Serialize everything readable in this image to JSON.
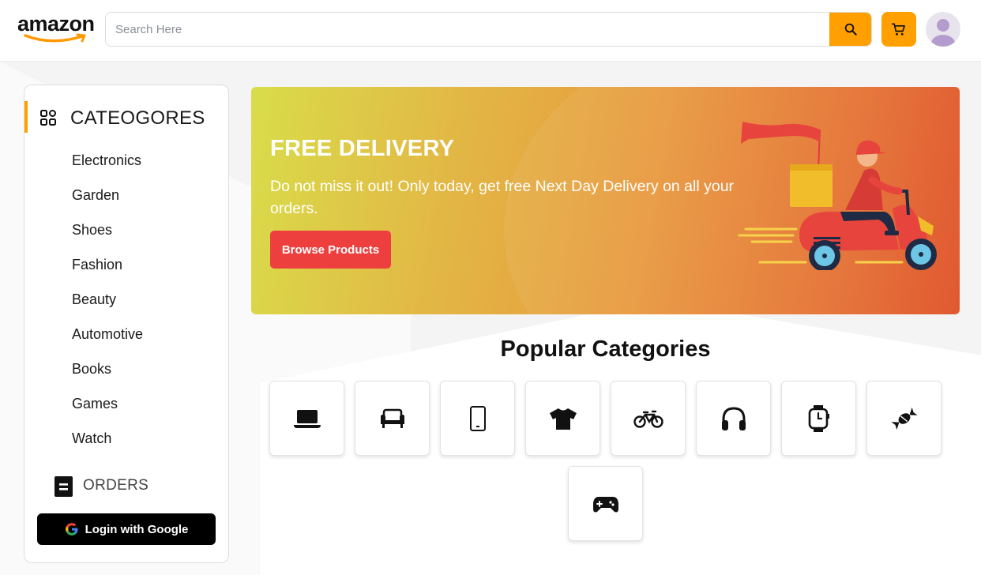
{
  "header": {
    "logo_text": "amazon",
    "search": {
      "placeholder": "Search Here",
      "value": ""
    },
    "search_icon": "search-icon",
    "cart_icon": "cart-icon",
    "avatar_icon": "user-avatar"
  },
  "sidebar": {
    "categories_title": "CATEOGORES",
    "categories_icon": "grid-icon",
    "items": [
      "Electronics",
      "Garden",
      "Shoes",
      "Fashion",
      "Beauty",
      "Automotive",
      "Books",
      "Games",
      "Watch"
    ],
    "orders_label": "ORDERS",
    "orders_icon": "document-icon",
    "login_label": "Login with Google"
  },
  "banner": {
    "title": "FREE DELIVERY",
    "text": "Do not miss it out! Only today, get free Next Day Delivery on all your orders.",
    "button_label": "Browse Products"
  },
  "popular": {
    "title": "Popular Categories",
    "icons": [
      "laptop-icon",
      "sofa-icon",
      "phone-icon",
      "tshirt-icon",
      "bicycle-icon",
      "headphones-icon",
      "smartwatch-icon",
      "candy-icon",
      "gamepad-icon"
    ]
  },
  "colors": {
    "accent": "#ff9f00",
    "banner_button": "#ee3f3f",
    "login_button": "#000000"
  }
}
